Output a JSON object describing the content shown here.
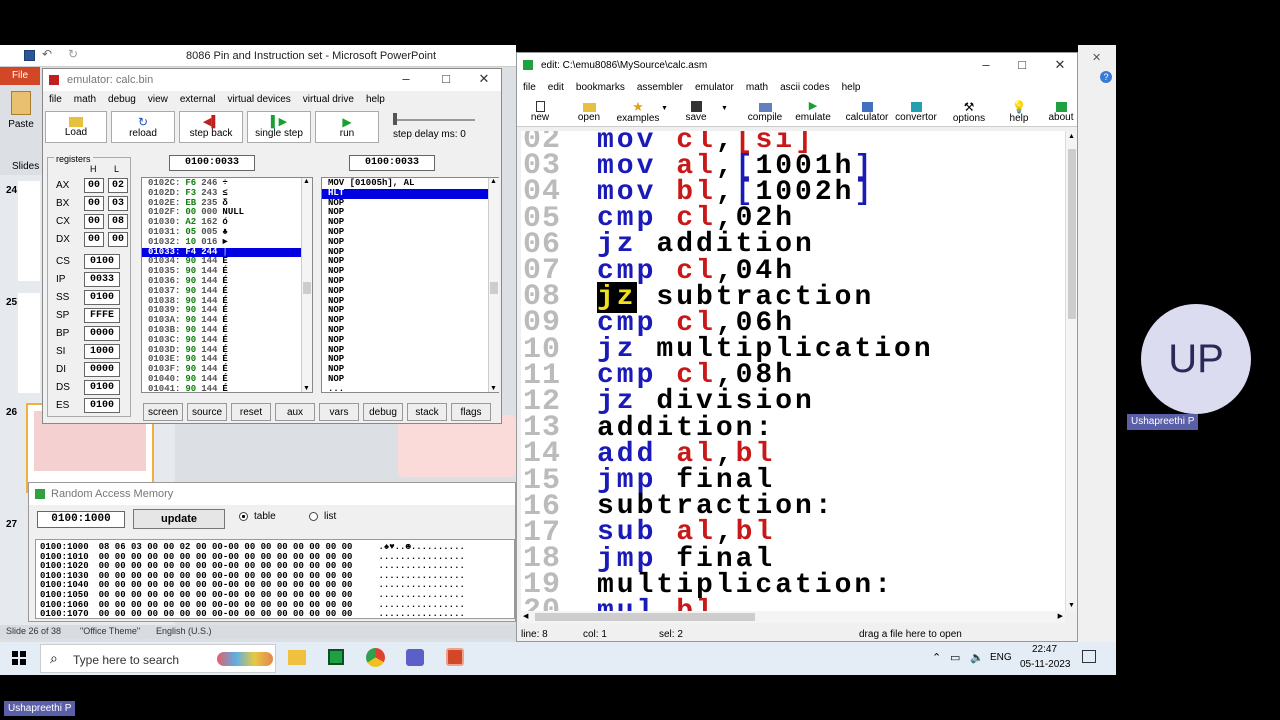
{
  "powerpoint": {
    "title": "8086 Pin and Instruction set  -  Microsoft PowerPoint",
    "file_tab": "File",
    "paste_label": "Paste",
    "slides_tab": "Slides",
    "slide_numbers": [
      "24",
      "25",
      "26",
      "27"
    ],
    "status": {
      "slide": "Slide 26 of 38",
      "theme": "\"Office Theme\"",
      "lang": "English (U.S.)"
    }
  },
  "emulator": {
    "title": "emulator: calc.bin",
    "menu": [
      "file",
      "math",
      "debug",
      "view",
      "external",
      "virtual devices",
      "virtual drive",
      "help"
    ],
    "toolbar": [
      {
        "label": "Load",
        "icon": "folder-icon"
      },
      {
        "label": "reload",
        "icon": "reload-icon"
      },
      {
        "label": "step back",
        "icon": "step-back-icon"
      },
      {
        "label": "single step",
        "icon": "single-step-icon"
      },
      {
        "label": "run",
        "icon": "run-icon"
      }
    ],
    "step_delay": "step delay ms: 0",
    "registers_label": "registers",
    "h_label": "H",
    "l_label": "L",
    "regs_hl": [
      {
        "name": "AX",
        "h": "00",
        "l": "02"
      },
      {
        "name": "BX",
        "h": "00",
        "l": "03"
      },
      {
        "name": "CX",
        "h": "00",
        "l": "08"
      },
      {
        "name": "DX",
        "h": "00",
        "l": "00"
      }
    ],
    "regs": [
      {
        "name": "CS",
        "v": "0100"
      },
      {
        "name": "IP",
        "v": "0033"
      },
      {
        "name": "SS",
        "v": "0100"
      },
      {
        "name": "SP",
        "v": "FFFE"
      },
      {
        "name": "BP",
        "v": "0000"
      },
      {
        "name": "SI",
        "v": "1000"
      },
      {
        "name": "DI",
        "v": "0000"
      },
      {
        "name": "DS",
        "v": "0100"
      },
      {
        "name": "ES",
        "v": "0100"
      }
    ],
    "addr_left": "0100:0033",
    "addr_right": "0100:0033",
    "mem_rows": [
      {
        "a": "0102C:",
        "h": "F6",
        "d": "246",
        "c": "÷"
      },
      {
        "a": "0102D:",
        "h": "F3",
        "d": "243",
        "c": "≤"
      },
      {
        "a": "0102E:",
        "h": "EB",
        "d": "235",
        "c": "δ"
      },
      {
        "a": "0102F:",
        "h": "00",
        "d": "000",
        "c": "NULL"
      },
      {
        "a": "01030:",
        "h": "A2",
        "d": "162",
        "c": "ó"
      },
      {
        "a": "01031:",
        "h": "05",
        "d": "005",
        "c": "♣"
      },
      {
        "a": "01032:",
        "h": "10",
        "d": "016",
        "c": "►"
      },
      {
        "a": "01033:",
        "h": "F4",
        "d": "244",
        "c": "⌠"
      },
      {
        "a": "01034:",
        "h": "90",
        "d": "144",
        "c": "É"
      },
      {
        "a": "01035:",
        "h": "90",
        "d": "144",
        "c": "É"
      },
      {
        "a": "01036:",
        "h": "90",
        "d": "144",
        "c": "É"
      },
      {
        "a": "01037:",
        "h": "90",
        "d": "144",
        "c": "É"
      },
      {
        "a": "01038:",
        "h": "90",
        "d": "144",
        "c": "É"
      },
      {
        "a": "01039:",
        "h": "90",
        "d": "144",
        "c": "É"
      },
      {
        "a": "0103A:",
        "h": "90",
        "d": "144",
        "c": "É"
      },
      {
        "a": "0103B:",
        "h": "90",
        "d": "144",
        "c": "É"
      },
      {
        "a": "0103C:",
        "h": "90",
        "d": "144",
        "c": "É"
      },
      {
        "a": "0103D:",
        "h": "90",
        "d": "144",
        "c": "É"
      },
      {
        "a": "0103E:",
        "h": "90",
        "d": "144",
        "c": "É"
      },
      {
        "a": "0103F:",
        "h": "90",
        "d": "144",
        "c": "É"
      },
      {
        "a": "01040:",
        "h": "90",
        "d": "144",
        "c": "É"
      },
      {
        "a": "01041:",
        "h": "90",
        "d": "144",
        "c": "É"
      }
    ],
    "selected_mem_index": 7,
    "disasm": [
      "MOV [01005h], AL",
      "HLT",
      "NOP",
      "NOP",
      "NOP",
      "NOP",
      "NOP",
      "NOP",
      "NOP",
      "NOP",
      "NOP",
      "NOP",
      "NOP",
      "NOP",
      "NOP",
      "NOP",
      "NOP",
      "NOP",
      "NOP",
      "NOP",
      "NOP",
      "..."
    ],
    "selected_disasm_index": 1,
    "bottom_buttons": [
      "screen",
      "source",
      "reset",
      "aux",
      "vars",
      "debug",
      "stack",
      "flags"
    ]
  },
  "ram": {
    "title": "Random Access Memory",
    "address": "0100:1000",
    "update_label": "update",
    "table_label": "table",
    "list_label": "list",
    "rows": [
      {
        "a": "0100:1000",
        "b": "08 06 03 00 00 02 00 00-00 00 00 00 00 00 00 00",
        "t": ".♠♥..☻.........."
      },
      {
        "a": "0100:1010",
        "b": "00 00 00 00 00 00 00 00-00 00 00 00 00 00 00 00",
        "t": "................"
      },
      {
        "a": "0100:1020",
        "b": "00 00 00 00 00 00 00 00-00 00 00 00 00 00 00 00",
        "t": "................"
      },
      {
        "a": "0100:1030",
        "b": "00 00 00 00 00 00 00 00-00 00 00 00 00 00 00 00",
        "t": "................"
      },
      {
        "a": "0100:1040",
        "b": "00 00 00 00 00 00 00 00-00 00 00 00 00 00 00 00",
        "t": "................"
      },
      {
        "a": "0100:1050",
        "b": "00 00 00 00 00 00 00 00-00 00 00 00 00 00 00 00",
        "t": "................"
      },
      {
        "a": "0100:1060",
        "b": "00 00 00 00 00 00 00 00-00 00 00 00 00 00 00 00",
        "t": "................"
      },
      {
        "a": "0100:1070",
        "b": "00 00 00 00 00 00 00 00-00 00 00 00 00 00 00 00",
        "t": "................"
      }
    ]
  },
  "editor": {
    "title": "edit: C:\\emu8086\\MySource\\calc.asm",
    "menu": [
      "file",
      "edit",
      "bookmarks",
      "assembler",
      "emulator",
      "math",
      "ascii codes",
      "help"
    ],
    "toolbar": [
      {
        "label": "new",
        "icon": "new-file-icon"
      },
      {
        "label": "open",
        "icon": "open-folder-icon"
      },
      {
        "label": "examples",
        "icon": "star-icon"
      },
      {
        "label": "save",
        "icon": "save-icon"
      },
      {
        "label": "compile",
        "icon": "compile-icon"
      },
      {
        "label": "emulate",
        "icon": "play-icon"
      },
      {
        "label": "calculator",
        "icon": "calculator-icon"
      },
      {
        "label": "convertor",
        "icon": "convertor-icon"
      },
      {
        "label": "options",
        "icon": "tools-icon"
      },
      {
        "label": "help",
        "icon": "help-bulb-icon"
      },
      {
        "label": "about",
        "icon": "about-icon"
      }
    ],
    "lines": [
      {
        "n": "02",
        "parts": [
          [
            "kw",
            "mov "
          ],
          [
            "reg",
            "cl"
          ],
          [
            "plain",
            ","
          ],
          [
            "reg",
            "[si]"
          ]
        ]
      },
      {
        "n": "03",
        "parts": [
          [
            "kw",
            "mov "
          ],
          [
            "reg",
            "al"
          ],
          [
            "plain",
            ","
          ],
          [
            "kw",
            "["
          ],
          [
            "plain",
            "1001h"
          ],
          [
            "kw",
            "]"
          ]
        ]
      },
      {
        "n": "04",
        "parts": [
          [
            "kw",
            "mov "
          ],
          [
            "reg",
            "bl"
          ],
          [
            "plain",
            ","
          ],
          [
            "kw",
            "["
          ],
          [
            "plain",
            "1002h"
          ],
          [
            "kw",
            "]"
          ]
        ]
      },
      {
        "n": "05",
        "parts": [
          [
            "kw",
            "cmp "
          ],
          [
            "reg",
            "cl"
          ],
          [
            "plain",
            ",02h"
          ]
        ]
      },
      {
        "n": "06",
        "parts": [
          [
            "kw",
            "jz "
          ],
          [
            "plain",
            "addition"
          ]
        ]
      },
      {
        "n": "07",
        "parts": [
          [
            "kw",
            "cmp "
          ],
          [
            "reg",
            "cl"
          ],
          [
            "plain",
            ",04h"
          ]
        ]
      },
      {
        "n": "08",
        "parts": [
          [
            "sel",
            "jz"
          ],
          [
            "plain",
            " subtraction"
          ]
        ]
      },
      {
        "n": "09",
        "parts": [
          [
            "kw",
            "cmp "
          ],
          [
            "reg",
            "cl"
          ],
          [
            "plain",
            ",06h"
          ]
        ]
      },
      {
        "n": "10",
        "parts": [
          [
            "kw",
            "jz "
          ],
          [
            "plain",
            "multiplication"
          ]
        ]
      },
      {
        "n": "11",
        "parts": [
          [
            "kw",
            "cmp "
          ],
          [
            "reg",
            "cl"
          ],
          [
            "plain",
            ",08h"
          ]
        ]
      },
      {
        "n": "12",
        "parts": [
          [
            "kw",
            "jz "
          ],
          [
            "plain",
            "division"
          ]
        ]
      },
      {
        "n": "13",
        "parts": [
          [
            "plain",
            "addition:"
          ]
        ]
      },
      {
        "n": "14",
        "parts": [
          [
            "kw",
            "add "
          ],
          [
            "reg",
            "al"
          ],
          [
            "plain",
            ","
          ],
          [
            "reg",
            "bl"
          ]
        ]
      },
      {
        "n": "15",
        "parts": [
          [
            "kw",
            "jmp "
          ],
          [
            "plain",
            "final"
          ]
        ]
      },
      {
        "n": "16",
        "parts": [
          [
            "plain",
            "subtraction:"
          ]
        ]
      },
      {
        "n": "17",
        "parts": [
          [
            "kw",
            "sub "
          ],
          [
            "reg",
            "al"
          ],
          [
            "plain",
            ","
          ],
          [
            "reg",
            "bl"
          ]
        ]
      },
      {
        "n": "18",
        "parts": [
          [
            "kw",
            "jmp "
          ],
          [
            "plain",
            "final"
          ]
        ]
      },
      {
        "n": "19",
        "parts": [
          [
            "plain",
            "multiplication:"
          ]
        ]
      },
      {
        "n": "20",
        "parts": [
          [
            "kw",
            "mul "
          ],
          [
            "reg",
            "bl"
          ]
        ]
      }
    ],
    "status": {
      "line": "line: 8",
      "col": "col: 1",
      "sel": "sel: 2",
      "hint": "drag a file here to open"
    }
  },
  "taskbar": {
    "search_placeholder": "Type here to search",
    "lang": "ENG",
    "time": "22:47",
    "date": "05-11-2023"
  },
  "participant": {
    "initials": "UP",
    "name": "Ushapreethi  P",
    "bottom_name": "Ushapreethi  P"
  },
  "colors": {
    "keyword": "#1a1ab8",
    "register": "#c81818",
    "selection": "#0000e0",
    "avatar_bg": "#dcdcf0"
  }
}
